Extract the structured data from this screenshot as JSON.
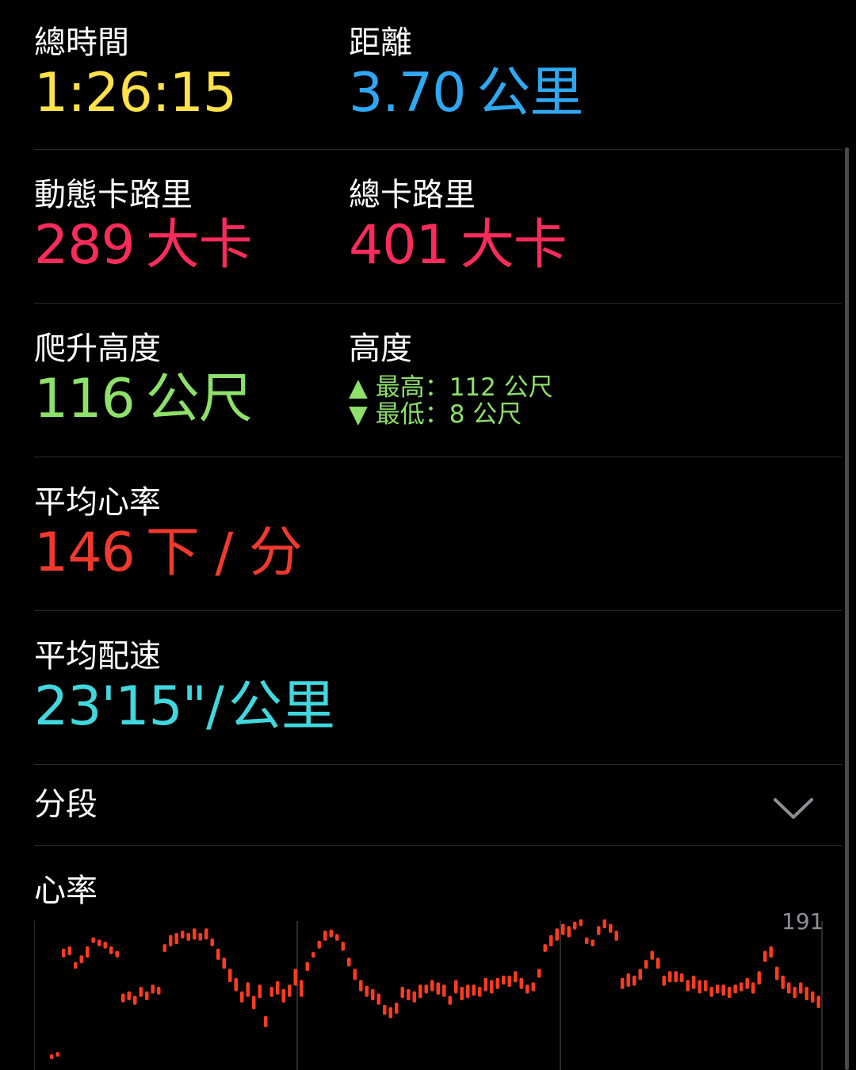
{
  "metrics": {
    "total_time": {
      "label": "總時間",
      "value": "1:26:15",
      "color": "#ffe14a"
    },
    "distance": {
      "label": "距離",
      "value": "3.70",
      "unit": "公里",
      "color": "#2fa8f3"
    },
    "active_cal": {
      "label": "動態卡路里",
      "value": "289",
      "unit": "大卡",
      "color": "#fa2c5b"
    },
    "total_cal": {
      "label": "總卡路里",
      "value": "401",
      "unit": "大卡",
      "color": "#fa2c5b"
    },
    "climb": {
      "label": "爬升高度",
      "value": "116",
      "unit": "公尺",
      "color": "#8ee06a"
    },
    "elevation": {
      "label": "高度",
      "max_text": "▲ 最高：112 公尺",
      "min_text": "▼ 最低：8 公尺"
    },
    "avg_hr": {
      "label": "平均心率",
      "value": "146",
      "unit": "下 / 分",
      "color": "#f2392d"
    },
    "avg_pace": {
      "label": "平均配速",
      "value": "23'15\"/",
      "unit": "公里",
      "color": "#40d8de"
    }
  },
  "splits": {
    "label": "分段",
    "icon": "chevron-down-icon"
  },
  "heart_rate": {
    "label": "心率",
    "max_label": "191",
    "bar_color": "#ff3b1f"
  },
  "chart_data": {
    "type": "bar",
    "ylim_top": 191,
    "series": [
      {
        "values": [
          [
            60,
            64
          ],
          [
            62,
            66
          ],
          [
            150,
            158
          ],
          [
            152,
            160
          ],
          [
            140,
            146
          ],
          [
            145,
            152
          ],
          [
            150,
            160
          ],
          [
            163,
            168
          ],
          [
            160,
            166
          ],
          [
            158,
            164
          ],
          [
            153,
            160
          ],
          [
            150,
            156
          ],
          [
            110,
            118
          ],
          [
            112,
            120
          ],
          [
            108,
            116
          ],
          [
            115,
            124
          ],
          [
            112,
            120
          ],
          [
            118,
            126
          ],
          [
            117,
            124
          ],
          [
            155,
            162
          ],
          [
            160,
            170
          ],
          [
            162,
            172
          ],
          [
            167,
            174
          ],
          [
            165,
            172
          ],
          [
            166,
            176
          ],
          [
            165,
            172
          ],
          [
            166,
            176
          ],
          [
            160,
            167
          ],
          [
            148,
            158
          ],
          [
            140,
            150
          ],
          [
            128,
            140
          ],
          [
            120,
            132
          ],
          [
            110,
            120
          ],
          [
            115,
            128
          ],
          [
            104,
            116
          ],
          [
            114,
            126
          ],
          [
            88,
            98
          ],
          [
            115,
            124
          ],
          [
            117,
            129
          ],
          [
            110,
            122
          ],
          [
            115,
            126
          ],
          [
            125,
            140
          ],
          [
            115,
            130
          ],
          [
            138,
            146
          ],
          [
            150,
            155
          ],
          [
            158,
            165
          ],
          [
            165,
            174
          ],
          [
            168,
            175
          ],
          [
            165,
            171
          ],
          [
            156,
            164
          ],
          [
            142,
            150
          ],
          [
            130,
            140
          ],
          [
            120,
            130
          ],
          [
            115,
            125
          ],
          [
            112,
            122
          ],
          [
            108,
            118
          ],
          [
            99,
            108
          ],
          [
            96,
            106
          ],
          [
            100,
            110
          ],
          [
            114,
            124
          ],
          [
            112,
            122
          ],
          [
            110,
            120
          ],
          [
            114,
            126
          ],
          [
            118,
            126
          ],
          [
            120,
            130
          ],
          [
            117,
            128
          ],
          [
            115,
            126
          ],
          [
            108,
            116
          ],
          [
            118,
            130
          ],
          [
            112,
            124
          ],
          [
            114,
            126
          ],
          [
            116,
            126
          ],
          [
            115,
            124
          ],
          [
            120,
            132
          ],
          [
            118,
            130
          ],
          [
            122,
            132
          ],
          [
            126,
            134
          ],
          [
            124,
            134
          ],
          [
            128,
            138
          ],
          [
            122,
            132
          ],
          [
            118,
            126
          ],
          [
            120,
            128
          ],
          [
            132,
            140
          ],
          [
            155,
            162
          ],
          [
            160,
            170
          ],
          [
            165,
            176
          ],
          [
            170,
            180
          ],
          [
            168,
            178
          ],
          [
            175,
            182
          ],
          [
            178,
            184
          ],
          [
            162,
            168
          ],
          [
            160,
            166
          ],
          [
            170,
            178
          ],
          [
            176,
            184
          ],
          [
            172,
            180
          ],
          [
            165,
            174
          ],
          [
            122,
            132
          ],
          [
            124,
            136
          ],
          [
            125,
            134
          ],
          [
            130,
            140
          ],
          [
            140,
            148
          ],
          [
            148,
            156
          ],
          [
            140,
            150
          ],
          [
            125,
            134
          ],
          [
            128,
            138
          ],
          [
            128,
            138
          ],
          [
            128,
            136
          ],
          [
            120,
            130
          ],
          [
            122,
            134
          ],
          [
            118,
            130
          ],
          [
            120,
            130
          ],
          [
            115,
            124
          ],
          [
            118,
            126
          ],
          [
            116,
            126
          ],
          [
            114,
            124
          ],
          [
            118,
            126
          ],
          [
            120,
            128
          ],
          [
            122,
            132
          ],
          [
            118,
            128
          ],
          [
            126,
            138
          ],
          [
            146,
            156
          ],
          [
            150,
            160
          ],
          [
            130,
            142
          ],
          [
            122,
            134
          ],
          [
            118,
            128
          ],
          [
            114,
            124
          ],
          [
            118,
            128
          ],
          [
            112,
            124
          ],
          [
            110,
            120
          ],
          [
            105,
            116
          ]
        ]
      }
    ]
  }
}
